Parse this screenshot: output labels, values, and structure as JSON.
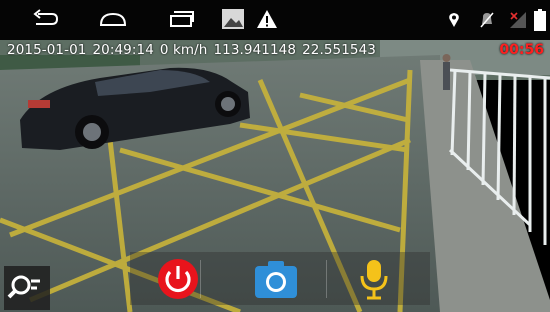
{
  "status_bar": {
    "nav_icons": [
      "back-icon",
      "home-icon",
      "recent-apps-icon",
      "gallery-icon",
      "warning-icon"
    ],
    "status_icons": [
      "location-icon",
      "mute-icon",
      "no-signal-icon",
      "battery-icon"
    ]
  },
  "overlay": {
    "date": "2015-01-01",
    "time": "20:49:14",
    "speed": "0 km/h",
    "longitude": "113.941148",
    "latitude": "22.551543",
    "recording_time": "00:56"
  },
  "toolbar": {
    "buttons": [
      "power-icon",
      "camera-icon",
      "microphone-icon"
    ]
  },
  "colors": {
    "recording": "#ff1f1f",
    "power": "#e8141c",
    "camera": "#2f8fd8",
    "microphone": "#f4c21a"
  }
}
